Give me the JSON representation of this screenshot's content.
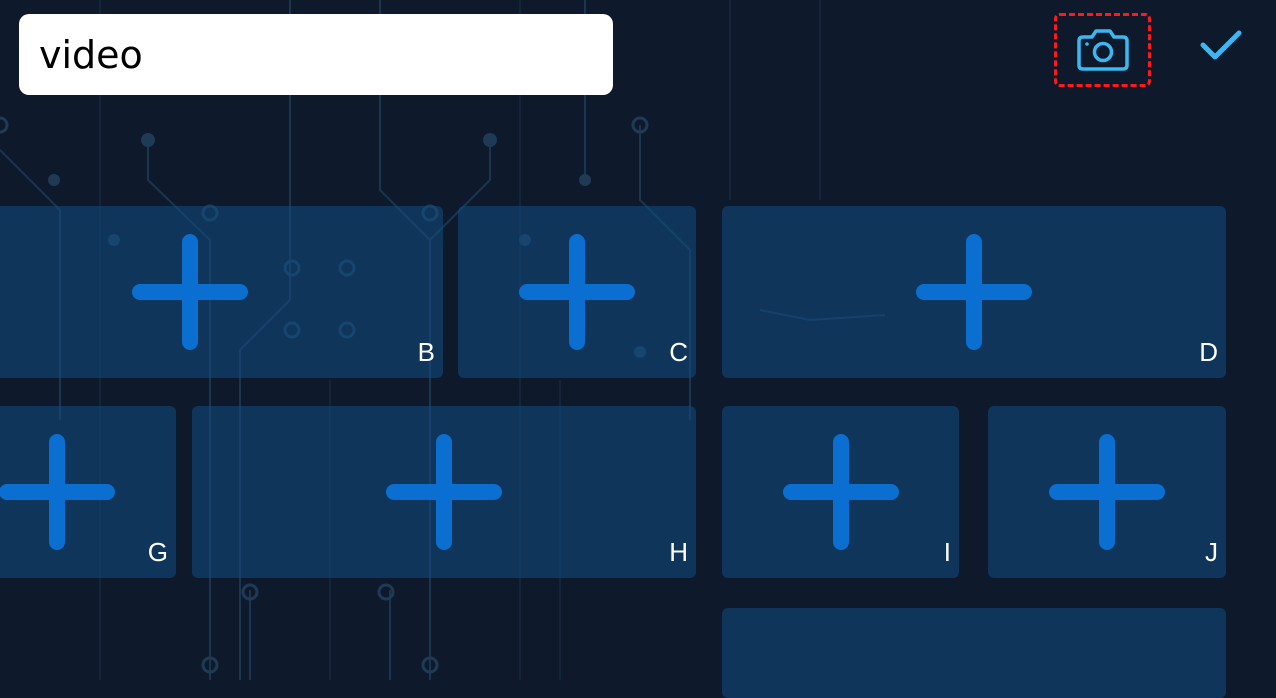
{
  "search": {
    "value": "video"
  },
  "toolbar": {
    "camera_icon": "camera-icon",
    "confirm_icon": "check-icon"
  },
  "colors": {
    "background": "#0e1a2c",
    "tile": "#0f4a7d",
    "plus": "#0a6fd1",
    "accent": "#3bb8f2",
    "highlight": "#ff1a1a"
  },
  "tiles": [
    {
      "label": "B"
    },
    {
      "label": "C"
    },
    {
      "label": "D"
    },
    {
      "label": "G"
    },
    {
      "label": "H"
    },
    {
      "label": "I"
    },
    {
      "label": "J"
    },
    {
      "label": ""
    }
  ]
}
